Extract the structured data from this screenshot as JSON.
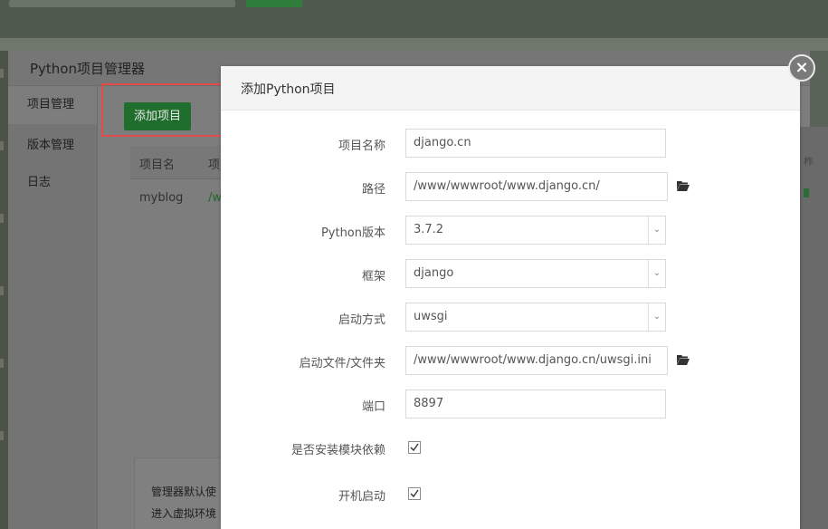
{
  "manager": {
    "title": "Python项目管理器",
    "nav": [
      "项目管理",
      "版本管理",
      "日志"
    ],
    "add_button_label": "添加项目",
    "table": {
      "headers": [
        "项目名",
        "项"
      ],
      "row": {
        "name": "myblog",
        "path": "/w"
      }
    },
    "note": [
      "管理器默认使",
      "进入虚拟环境"
    ],
    "right_edge_text": "柞"
  },
  "modal": {
    "title": "添加Python项目",
    "close_label": "×",
    "fields": {
      "name": {
        "label": "项目名称",
        "value": "django.cn"
      },
      "path": {
        "label": "路径",
        "value": "/www/wwwroot/www.django.cn/"
      },
      "python_version": {
        "label": "Python版本",
        "value": "3.7.2"
      },
      "framework": {
        "label": "框架",
        "value": "django"
      },
      "start_method": {
        "label": "启动方式",
        "value": "uwsgi"
      },
      "start_file": {
        "label": "启动文件/文件夹",
        "value": "/www/wwwroot/www.django.cn/uwsgi.ini"
      },
      "port": {
        "label": "端口",
        "value": "8897"
      },
      "install_deps": {
        "label": "是否安装模块依赖",
        "checked": true
      },
      "autostart": {
        "label": "开机启动",
        "checked": true
      }
    }
  },
  "colors": {
    "brand_green": "#20a53a",
    "highlight_red": "#e24c4c"
  }
}
